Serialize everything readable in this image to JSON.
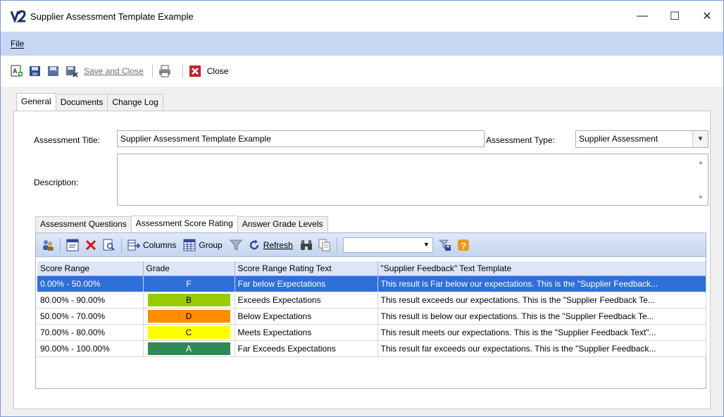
{
  "window": {
    "title": "Supplier Assessment Template Example",
    "controls": {
      "minimize": "—",
      "maximize": "☐",
      "close": "✕"
    }
  },
  "menu": {
    "file": "File"
  },
  "toolbar": {
    "save_and_close": "Save and Close",
    "close": "Close"
  },
  "tabs": [
    "General",
    "Documents",
    "Change Log"
  ],
  "form": {
    "assessment_title_label": "Assessment Title:",
    "assessment_title_value": "Supplier Assessment Template Example",
    "assessment_type_label": "Assessment Type:",
    "assessment_type_value": "Supplier Assessment",
    "description_label": "Description:",
    "description_value": ""
  },
  "inner_tabs": [
    "Assessment Questions",
    "Assessment Score Rating",
    "Answer Grade Levels"
  ],
  "grid_toolbar": {
    "columns": "Columns",
    "group": "Group",
    "refresh": "Refresh"
  },
  "grid": {
    "headers": [
      "Score Range",
      "Grade",
      "Score Range Rating Text",
      "\"Supplier Feedback\" Text Template"
    ],
    "rows": [
      {
        "range": "0.00% - 50.00%",
        "grade": "F",
        "grade_color": "#2f6fd8",
        "rating": "Far below Expectations",
        "feedback": "This result is Far below our expectations. This is the \"Supplier Feedback...",
        "selected": true
      },
      {
        "range": "80.00% - 90.00%",
        "grade": "B",
        "grade_color": "#99cc00",
        "rating": "Exceeds Expectations",
        "feedback": "This result exceeds our expectations. This is the \"Supplier Feedback Te...",
        "selected": false
      },
      {
        "range": "50.00% - 70.00%",
        "grade": "D",
        "grade_color": "#ff8c00",
        "rating": "Below Expectations",
        "feedback": "This result is below our expectations. This is the \"Supplier Feedback Te...",
        "selected": false
      },
      {
        "range": "70.00% - 80.00%",
        "grade": "C",
        "grade_color": "#ffff00",
        "rating": "Meets Expectations",
        "feedback": "This result meets our expectations. This is the \"Supplier Feedback Text\"...",
        "selected": false
      },
      {
        "range": "90.00% - 100.00%",
        "grade": "A",
        "grade_color": "#2e8b57",
        "rating": "Far Exceeds Expectations",
        "feedback": "This result far exceeds our expectations. This is the \"Supplier Feedback...",
        "selected": false
      }
    ]
  },
  "colors": {
    "menubar": "#c6d6f3",
    "selection": "#2f6fd8",
    "accent": "#1f3f8f"
  }
}
